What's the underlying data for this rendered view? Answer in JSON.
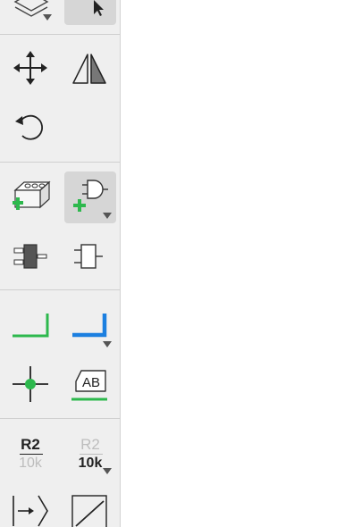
{
  "toolbar": {
    "tools": [
      {
        "id": "layers",
        "icon": "layers-icon",
        "has_submenu": true
      },
      {
        "id": "select",
        "icon": "cursor-icon",
        "active": true
      },
      {
        "id": "move",
        "icon": "move-icon"
      },
      {
        "id": "mirror",
        "icon": "mirror-icon"
      },
      {
        "id": "rotate",
        "icon": "rotate-icon"
      },
      {
        "id": "add-part",
        "icon": "add-part-icon"
      },
      {
        "id": "add-gate",
        "icon": "add-gate-icon",
        "active": true,
        "has_submenu": true
      },
      {
        "id": "pin-filled",
        "icon": "pin-filled-icon"
      },
      {
        "id": "pin-outline",
        "icon": "pin-outline-icon"
      },
      {
        "id": "wire",
        "icon": "wire-icon",
        "color": "#2db84d"
      },
      {
        "id": "bus",
        "icon": "bus-icon",
        "color": "#1b7fe0",
        "has_submenu": true
      },
      {
        "id": "junction",
        "icon": "junction-icon",
        "color": "#2db84d"
      },
      {
        "id": "net-label",
        "icon": "net-label-icon",
        "text": "AB"
      },
      {
        "id": "name-tool",
        "icon": "name-label-icon",
        "name": "R2",
        "value": "10k"
      },
      {
        "id": "value-tool",
        "icon": "value-label-icon",
        "name": "R2",
        "value": "10k",
        "has_submenu": true
      },
      {
        "id": "port",
        "icon": "port-icon"
      },
      {
        "id": "line",
        "icon": "line-icon"
      }
    ]
  }
}
